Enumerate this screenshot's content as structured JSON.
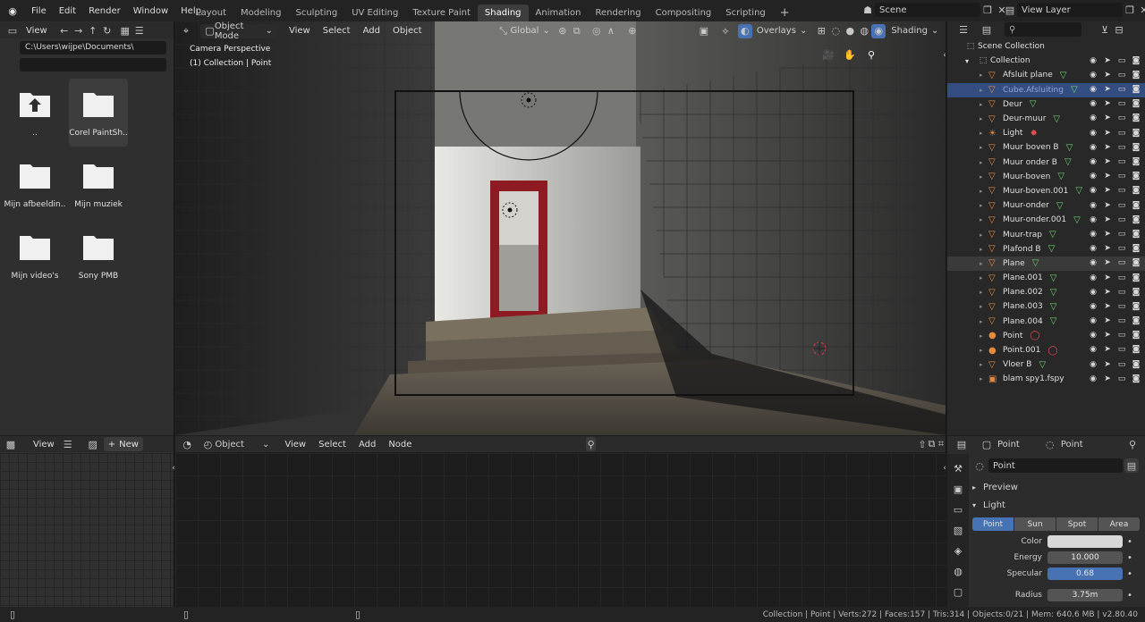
{
  "topbar": {
    "menus": [
      "File",
      "Edit",
      "Render",
      "Window",
      "Help"
    ],
    "workspaces": [
      "Layout",
      "Modeling",
      "Sculpting",
      "UV Editing",
      "Texture Paint",
      "Shading",
      "Animation",
      "Rendering",
      "Compositing",
      "Scripting"
    ],
    "active_workspace": "Shading",
    "add_tab": "+",
    "scene_name": "Scene",
    "view_layer_name": "View Layer"
  },
  "filebrowser": {
    "view_label": "View",
    "path": "C:\\Users\\wijpe\\Documents\\",
    "filter": "",
    "items": [
      {
        "name": "..",
        "icon": "parent-folder-icon"
      },
      {
        "name": "Corel PaintSh..",
        "icon": "folder-icon"
      },
      {
        "name": "Mijn afbeeldin..",
        "icon": "folder-icon"
      },
      {
        "name": "Mijn muziek",
        "icon": "folder-icon"
      },
      {
        "name": "Mijn video's",
        "icon": "folder-icon"
      },
      {
        "name": "Sony PMB",
        "icon": "folder-icon"
      }
    ]
  },
  "viewport": {
    "mode": "Object Mode",
    "menus": [
      "View",
      "Select",
      "Add",
      "Object"
    ],
    "transform": "Global",
    "overlays": "Overlays",
    "shading": "Shading",
    "camera_label": "Camera Perspective",
    "collection_label": "(1) Collection | Point"
  },
  "outliner": {
    "search": "",
    "root": "Scene Collection",
    "collection": "Collection",
    "items": [
      {
        "name": "Afsluit plane",
        "type": "mesh"
      },
      {
        "name": "Cube.Afsluiting",
        "type": "mesh",
        "selected": true
      },
      {
        "name": "Deur",
        "type": "mesh"
      },
      {
        "name": "Deur-muur",
        "type": "mesh"
      },
      {
        "name": "Light",
        "type": "light"
      },
      {
        "name": "Muur boven B",
        "type": "mesh"
      },
      {
        "name": "Muur onder B",
        "type": "mesh"
      },
      {
        "name": "Muur-boven",
        "type": "mesh"
      },
      {
        "name": "Muur-boven.001",
        "type": "mesh"
      },
      {
        "name": "Muur-onder",
        "type": "mesh"
      },
      {
        "name": "Muur-onder.001",
        "type": "mesh"
      },
      {
        "name": "Muur-trap",
        "type": "mesh"
      },
      {
        "name": "Plafond B",
        "type": "mesh"
      },
      {
        "name": "Plane",
        "type": "mesh",
        "highlight": true
      },
      {
        "name": "Plane.001",
        "type": "mesh"
      },
      {
        "name": "Plane.002",
        "type": "mesh"
      },
      {
        "name": "Plane.003",
        "type": "mesh"
      },
      {
        "name": "Plane.004",
        "type": "mesh"
      },
      {
        "name": "Point",
        "type": "point"
      },
      {
        "name": "Point.001",
        "type": "point"
      },
      {
        "name": "Vloer B",
        "type": "mesh"
      },
      {
        "name": "blam spy1.fspy",
        "type": "camera"
      }
    ]
  },
  "imgeditor": {
    "view_label": "View",
    "new_label": "New"
  },
  "nodeeditor": {
    "mode": "Object",
    "menus": [
      "View",
      "Select",
      "Add",
      "Node"
    ]
  },
  "properties": {
    "object_name": "Point",
    "data_name": "Point",
    "light_data_name": "Point",
    "panel_preview": "Preview",
    "panel_light": "Light",
    "light_types": [
      "Point",
      "Sun",
      "Spot",
      "Area"
    ],
    "active_light_type": "Point",
    "color_label": "Color",
    "energy_label": "Energy",
    "energy_value": "10.000",
    "specular_label": "Specular",
    "specular_value": "0.68",
    "radius_label": "Radius",
    "radius_value": "3.75m"
  },
  "statusbar": {
    "info": "Collection | Point | Verts:272 | Faces:157 | Tris:314 | Objects:0/21 | Mem: 640.6 MB | v2.80.40"
  }
}
